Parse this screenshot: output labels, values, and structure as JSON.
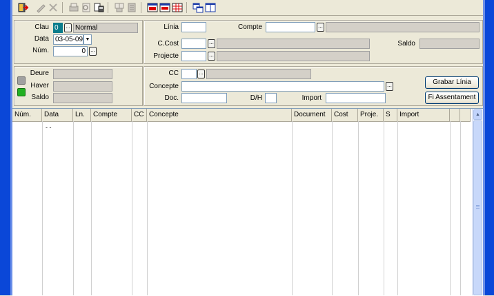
{
  "toolbar": {
    "buttons": [
      {
        "name": "exit-icon"
      },
      {
        "name": "edit-icon"
      },
      {
        "name": "delete-icon"
      },
      {
        "name": "print-icon"
      },
      {
        "name": "preview-icon"
      },
      {
        "name": "report-icon"
      },
      {
        "name": "copy-icon"
      },
      {
        "name": "paste-icon"
      },
      {
        "name": "import-icon"
      },
      {
        "name": "export-icon"
      },
      {
        "name": "grid-icon"
      },
      {
        "name": "window-icon"
      },
      {
        "name": "windows-icon"
      }
    ]
  },
  "header": {
    "clau_label": "Clau",
    "clau_code": "0",
    "clau_value": "Normal",
    "data_label": "Data",
    "data_value": "03-05-09",
    "num_label": "Núm.",
    "num_value": "0"
  },
  "totals": {
    "deure_label": "Deure",
    "haver_label": "Haver",
    "saldo_label": "Saldo"
  },
  "line": {
    "linia_label": "Línia",
    "compte_label": "Compte",
    "ccost_label": "C.Cost",
    "projecte_label": "Projecte",
    "saldo_label": "Saldo",
    "cc_label": "CC",
    "concepte_label": "Concepte",
    "doc_label": "Doc.",
    "dh_label": "D/H",
    "import_label": "Import",
    "dots": "..."
  },
  "buttons": {
    "grabar": "Grabar Línia",
    "fi": "Fi Assentament"
  },
  "grid": {
    "columns": [
      "Núm.",
      "Data",
      "Ln.",
      "Compte",
      "CC",
      "Concepte",
      "Document",
      "Cost",
      "Proje.",
      "S",
      "Import"
    ],
    "first_row_data": "- -"
  },
  "colors": {
    "frame": "#0a47d8",
    "deure_icon": "#a0a0a0",
    "haver_icon": "#22b022"
  }
}
